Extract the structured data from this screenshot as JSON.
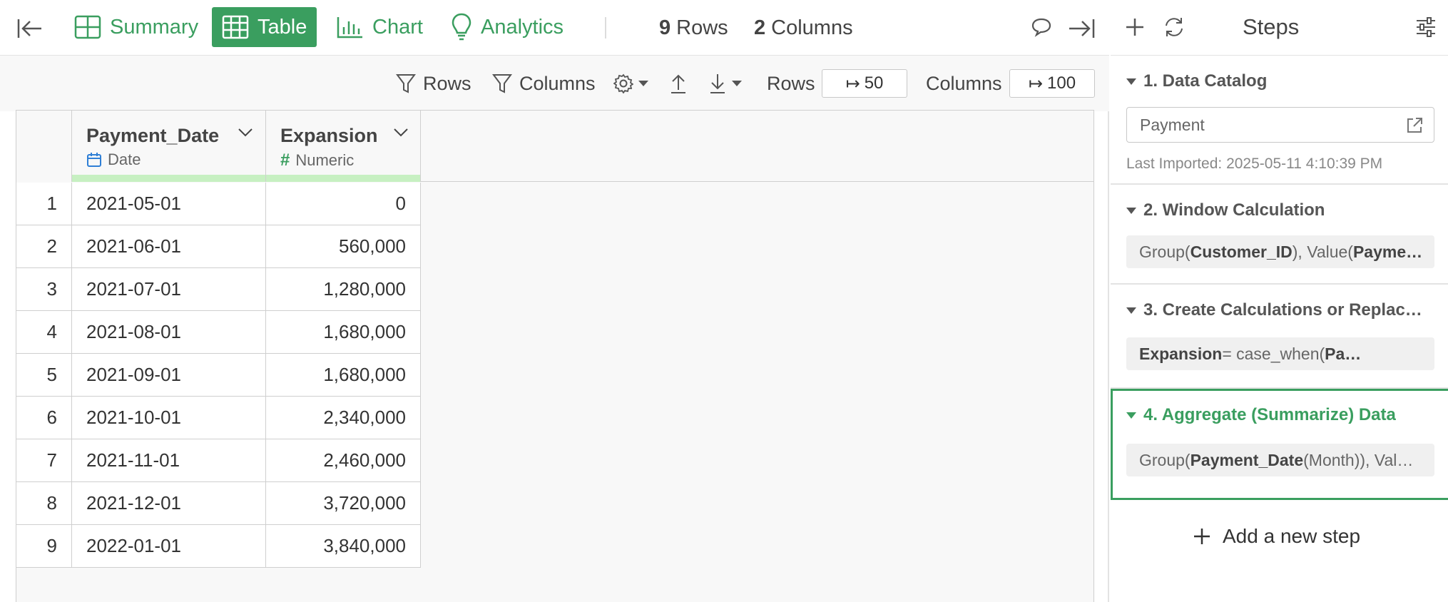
{
  "topbar": {
    "tabs": [
      {
        "label": "Summary",
        "icon": "summary-grid-icon",
        "active": false
      },
      {
        "label": "Table",
        "icon": "table-icon",
        "active": true
      },
      {
        "label": "Chart",
        "icon": "bar-chart-icon",
        "active": false
      },
      {
        "label": "Analytics",
        "icon": "lightbulb-icon",
        "active": false
      }
    ],
    "rows_count": "9",
    "rows_label": "Rows",
    "cols_count": "2",
    "cols_label": "Columns"
  },
  "toolbar": {
    "rows_filter": "Rows",
    "columns_filter": "Columns",
    "rows_limit_label": "Rows",
    "rows_limit_value": "50",
    "cols_limit_label": "Columns",
    "cols_limit_value": "100"
  },
  "table": {
    "columns": [
      {
        "name": "Payment_Date",
        "type": "Date",
        "type_icon": "calendar-icon"
      },
      {
        "name": "Expansion",
        "type": "Numeric",
        "type_icon": "hash-icon"
      }
    ],
    "rows": [
      {
        "idx": "1",
        "date": "2021-05-01",
        "value": "0"
      },
      {
        "idx": "2",
        "date": "2021-06-01",
        "value": "560,000"
      },
      {
        "idx": "3",
        "date": "2021-07-01",
        "value": "1,280,000"
      },
      {
        "idx": "4",
        "date": "2021-08-01",
        "value": "1,680,000"
      },
      {
        "idx": "5",
        "date": "2021-09-01",
        "value": "1,680,000"
      },
      {
        "idx": "6",
        "date": "2021-10-01",
        "value": "2,340,000"
      },
      {
        "idx": "7",
        "date": "2021-11-01",
        "value": "2,460,000"
      },
      {
        "idx": "8",
        "date": "2021-12-01",
        "value": "3,720,000"
      },
      {
        "idx": "9",
        "date": "2022-01-01",
        "value": "3,840,000"
      }
    ]
  },
  "steps_panel": {
    "title": "Steps",
    "steps": [
      {
        "title": "1. Data Catalog",
        "source": "Payment",
        "imported": "Last Imported: 2025-05-11 4:10:39 PM"
      },
      {
        "title": "2. Window Calculation",
        "sum_pre": "Group(",
        "sum_b1": "Customer_ID",
        "sum_mid": "), Value(",
        "sum_b2": "Payme…"
      },
      {
        "title": "3. Create Calculations or Replac…",
        "sum_b1": "Expansion",
        "sum_mid": " = case_when(",
        "sum_b2": "Pa…"
      },
      {
        "title": "4. Aggregate (Summarize) Data",
        "sum_pre": "Group(",
        "sum_b1": "Payment_Date",
        "sum_mid": " (Month)), Val…",
        "active": true
      }
    ],
    "add_step": "Add a new step"
  },
  "colors": {
    "accent": "#3a9e5f",
    "header_bar": "#c7f0c2",
    "calendar": "#2f7fd6"
  }
}
